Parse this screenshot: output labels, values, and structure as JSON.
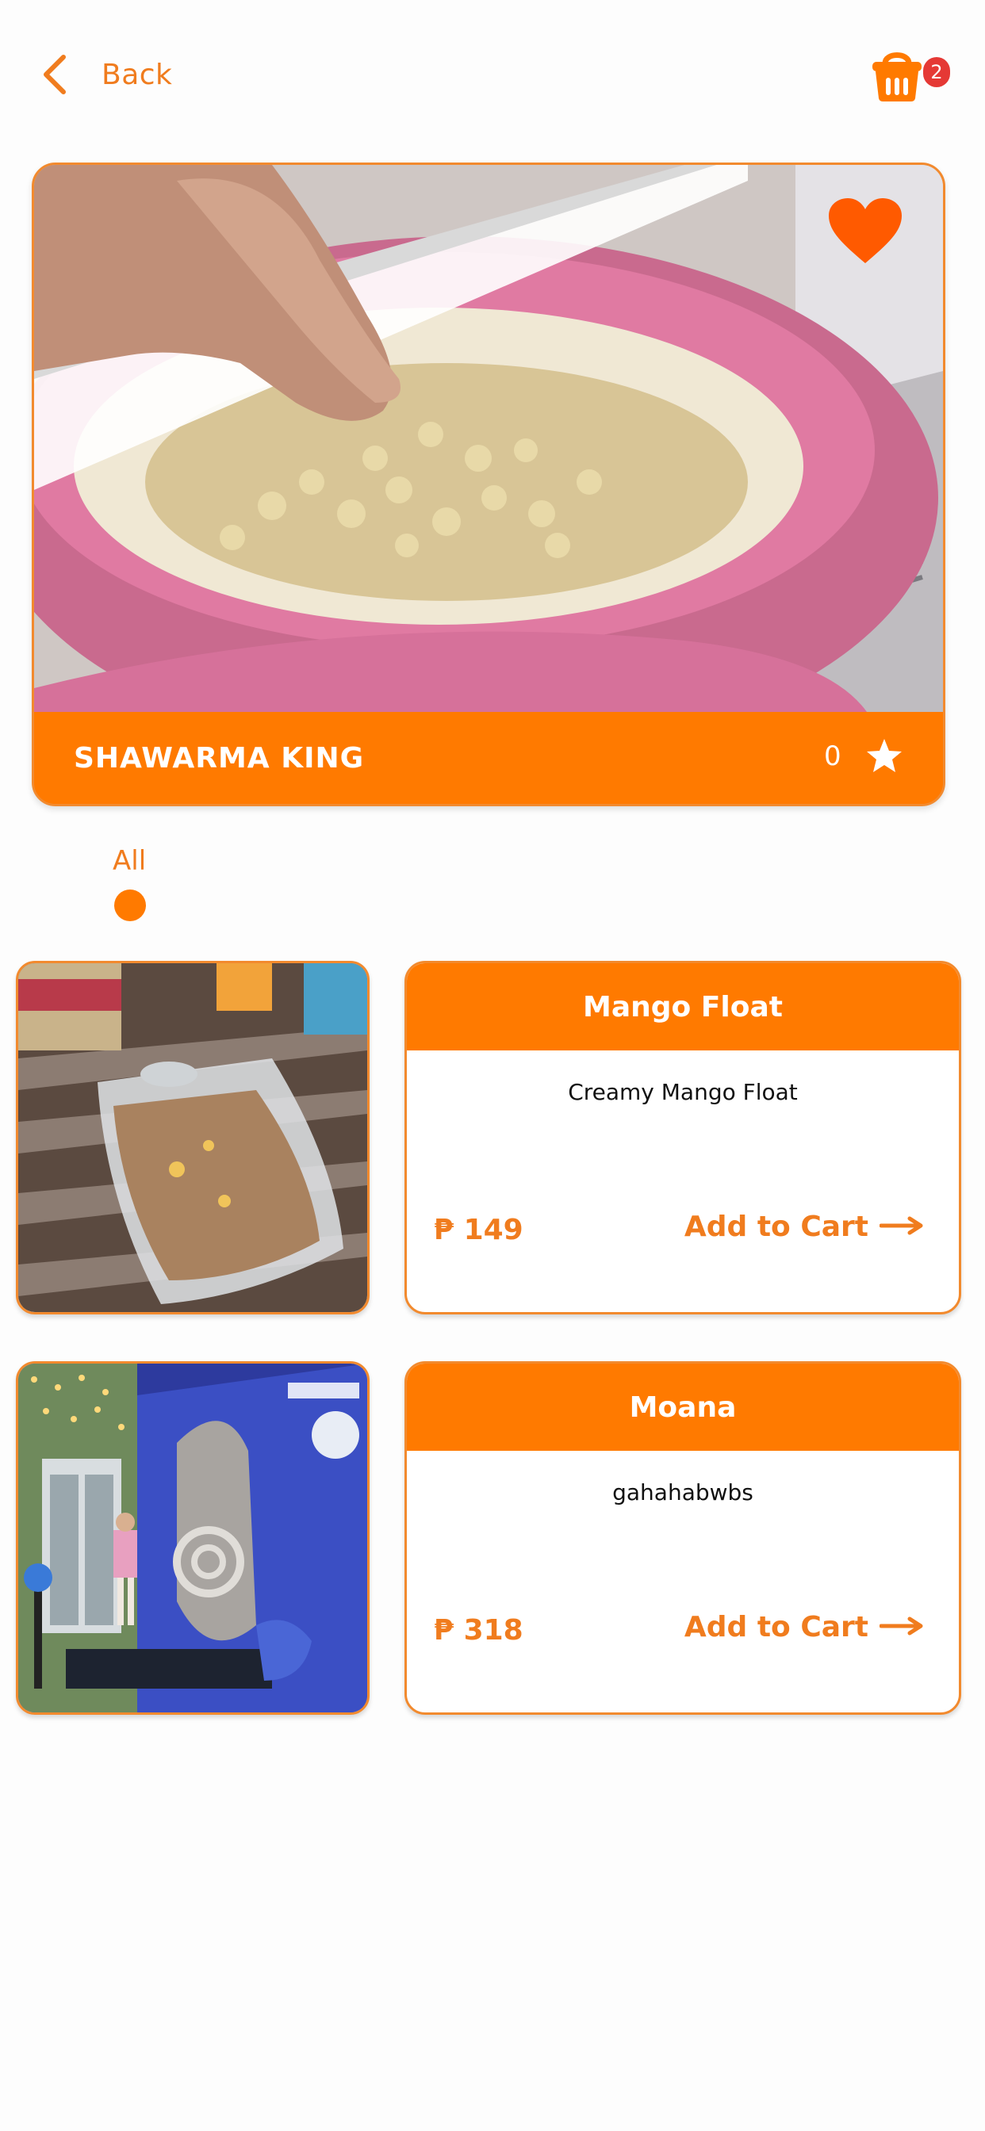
{
  "header": {
    "back_label": "Back",
    "back_icon": "chevron-left-icon",
    "cart_icon": "basket-icon",
    "cart_count": "2"
  },
  "store": {
    "name": "SHAWARMA KING",
    "rating_count": "0",
    "favorite_icon": "heart-icon",
    "rating_icon": "star-icon"
  },
  "categories": [
    {
      "label": "All",
      "selected": true
    }
  ],
  "products": [
    {
      "name": "Mango Float",
      "description": "Creamy Mango Float",
      "price": "₱ 149",
      "add_label": "Add to Cart"
    },
    {
      "name": "Moana",
      "description": "gahahabwbs",
      "price": "₱ 318",
      "add_label": "Add to Cart"
    }
  ],
  "colors": {
    "accent": "#ff7a00",
    "accent_text": "#f07c1e",
    "badge": "#e53935",
    "heart": "#ff5a00"
  }
}
